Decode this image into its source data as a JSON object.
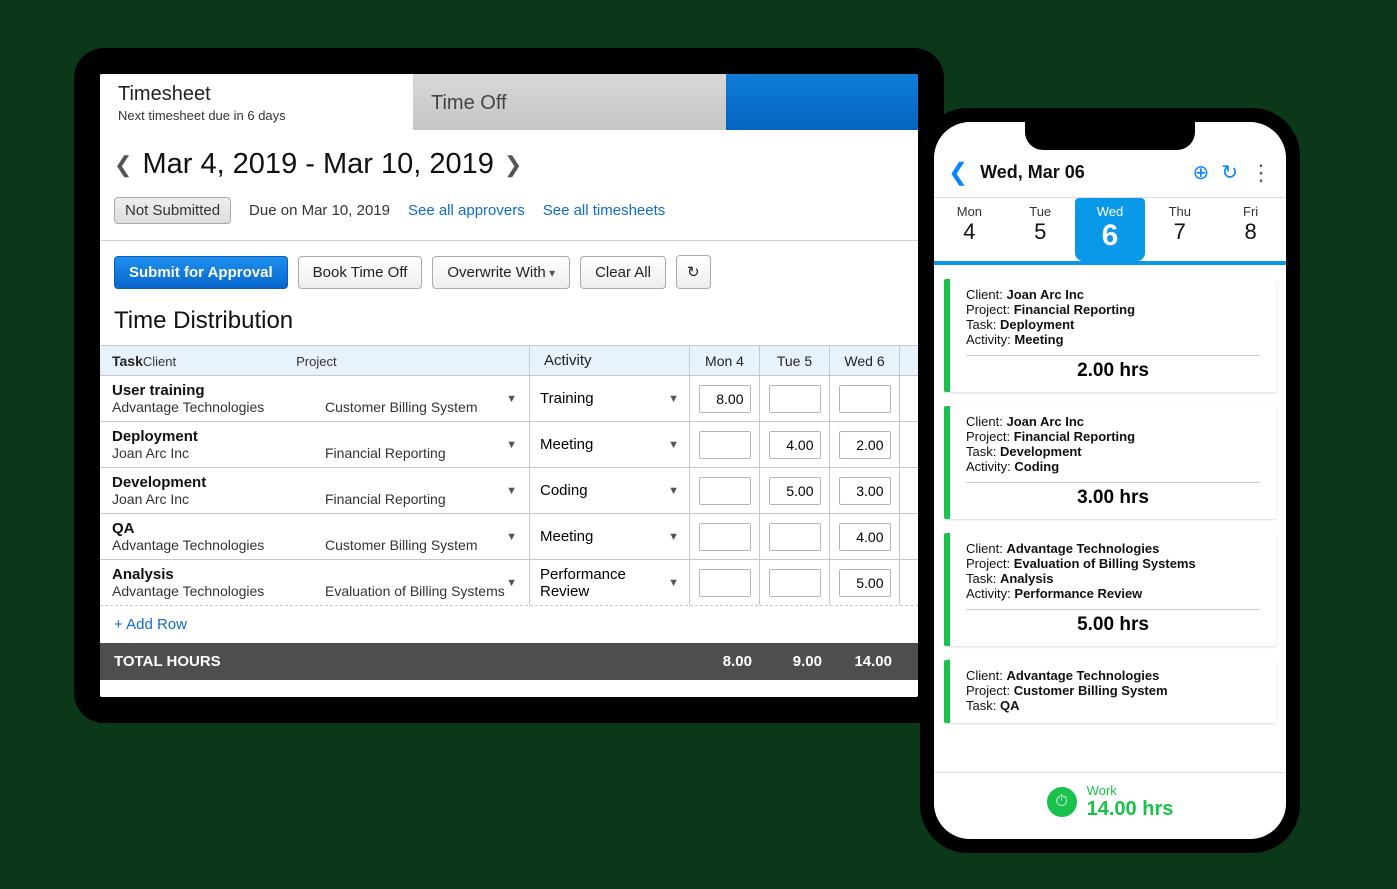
{
  "tablet": {
    "tabs": {
      "timesheet": {
        "label": "Timesheet",
        "subtitle": "Next timesheet due in 6 days"
      },
      "timeoff": {
        "label": "Time Off"
      }
    },
    "date_range": "Mar 4, 2019 - Mar 10, 2019",
    "status": {
      "pill": "Not Submitted",
      "due": "Due on Mar 10, 2019",
      "approvers_link": "See all approvers",
      "timesheets_link": "See all timesheets"
    },
    "toolbar": {
      "submit": "Submit for Approval",
      "book": "Book Time Off",
      "overwrite": "Overwrite With",
      "clear": "Clear All"
    },
    "section_title": "Time Distribution",
    "headers": {
      "task": "Task",
      "client": "Client",
      "project": "Project",
      "activity": "Activity",
      "days": [
        "Mon 4",
        "Tue 5",
        "Wed 6"
      ]
    },
    "rows": [
      {
        "task": "User training",
        "client": "Advantage Technologies",
        "project": "Customer Billing System",
        "activity": "Training",
        "hours": [
          "8.00",
          "",
          ""
        ]
      },
      {
        "task": "Deployment",
        "client": "Joan Arc Inc",
        "project": "Financial Reporting",
        "activity": "Meeting",
        "hours": [
          "",
          "4.00",
          "2.00"
        ]
      },
      {
        "task": "Development",
        "client": "Joan Arc Inc",
        "project": "Financial Reporting",
        "activity": "Coding",
        "hours": [
          "",
          "5.00",
          "3.00"
        ]
      },
      {
        "task": "QA",
        "client": "Advantage Technologies",
        "project": "Customer Billing System",
        "activity": "Meeting",
        "hours": [
          "",
          "",
          "4.00"
        ]
      },
      {
        "task": "Analysis",
        "client": "Advantage Technologies",
        "project": "Evaluation of Billing Systems",
        "activity": "Performance Review",
        "hours": [
          "",
          "",
          "5.00"
        ]
      }
    ],
    "add_row": "+ Add Row",
    "totals": {
      "label": "TOTAL HOURS",
      "values": [
        "8.00",
        "9.00",
        "14.00"
      ]
    }
  },
  "phone": {
    "header": {
      "title": "Wed, Mar 06"
    },
    "days": [
      {
        "dow": "Mon",
        "dnum": "4"
      },
      {
        "dow": "Tue",
        "dnum": "5"
      },
      {
        "dow": "Wed",
        "dnum": "6",
        "active": true
      },
      {
        "dow": "Thu",
        "dnum": "7"
      },
      {
        "dow": "Fri",
        "dnum": "8"
      }
    ],
    "labels": {
      "client": "Client:",
      "project": "Project:",
      "task": "Task:",
      "activity": "Activity:"
    },
    "cards": [
      {
        "client": "Joan Arc Inc",
        "project": "Financial Reporting",
        "task": "Deployment",
        "activity": "Meeting",
        "hours": "2.00 hrs"
      },
      {
        "client": "Joan Arc Inc",
        "project": "Financial Reporting",
        "task": "Development",
        "activity": "Coding",
        "hours": "3.00 hrs"
      },
      {
        "client": "Advantage Technologies",
        "project": "Evaluation of Billing Systems",
        "task": "Analysis",
        "activity": "Performance Review",
        "hours": "5.00 hrs"
      },
      {
        "client": "Advantage Technologies",
        "project": "Customer Billing System",
        "task": "QA",
        "activity": "",
        "hours": ""
      }
    ],
    "footer": {
      "label": "Work",
      "hours": "14.00 hrs"
    }
  }
}
